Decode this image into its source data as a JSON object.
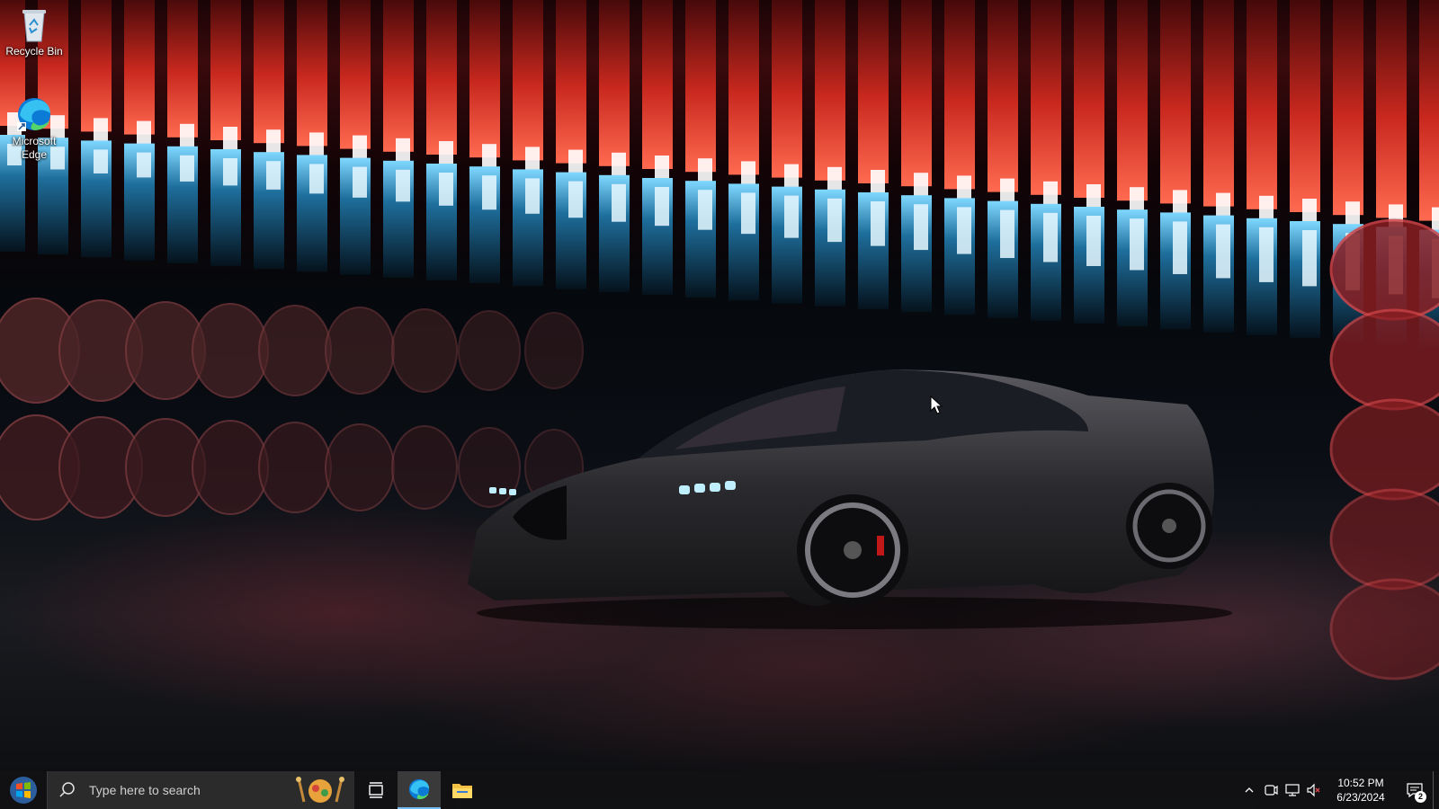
{
  "desktop": {
    "icons": [
      {
        "label": "Recycle Bin",
        "icon": "recycle-bin-icon"
      },
      {
        "label": "Microsoft Edge",
        "icon": "edge-icon"
      }
    ]
  },
  "taskbar": {
    "start": {
      "icon": "windows-logo-icon"
    },
    "search": {
      "placeholder": "Type here to search",
      "icon": "search-icon"
    },
    "pinned": [
      {
        "name": "Task View",
        "icon": "task-view-icon"
      },
      {
        "name": "Microsoft Edge",
        "icon": "edge-icon",
        "active": true
      },
      {
        "name": "File Explorer",
        "icon": "folder-icon"
      }
    ],
    "tray": {
      "icons": [
        "chevron-up-icon",
        "meet-now-icon",
        "network-icon",
        "volume-muted-icon"
      ],
      "time": "10:52 PM",
      "date": "6/23/2024",
      "notifications": {
        "count": "2",
        "icon": "action-center-icon"
      }
    }
  },
  "colors": {
    "taskbar_bg": "#121214",
    "search_bg": "#2b2b2b",
    "accent": "#76b9ed",
    "wall_red": "#c8281e",
    "wall_blue": "#1e6e9c"
  }
}
